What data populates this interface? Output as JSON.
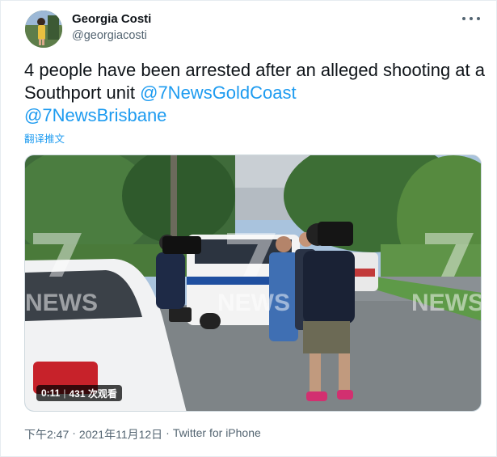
{
  "author": {
    "display_name": "Georgia Costi",
    "handle": "@georgiacosti"
  },
  "tweet": {
    "text_prefix": "4 people have been arrested after an alleged shooting at a Southport unit ",
    "mention_1": "@7NewsGoldCoast",
    "mention_2": "@7NewsBrisbane",
    "translate_label": "翻译推文"
  },
  "media": {
    "elapsed": "0:11",
    "views": "431 次观看",
    "watermark": "NEWS"
  },
  "meta": {
    "time": "下午2:47",
    "date": "2021年11月12日",
    "separator_1": "·",
    "separator_2": "·",
    "source": "Twitter for iPhone"
  },
  "icons": {
    "more": "more-dots-icon"
  },
  "colors": {
    "link": "#1d9bf0",
    "text": "#0f1419",
    "muted": "#536471"
  }
}
